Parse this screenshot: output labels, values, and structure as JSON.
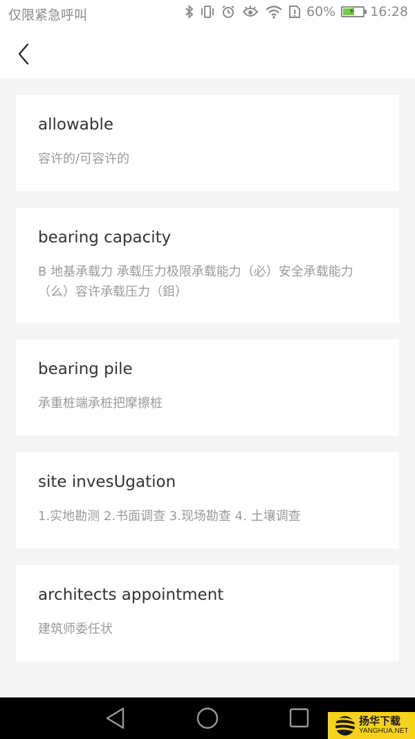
{
  "status_bar": {
    "carrier_text": "仅限紧急呼叫",
    "icons": [
      "bluetooth-icon",
      "vibrate-icon",
      "alarm-icon",
      "eye-comfort-icon",
      "wifi-icon",
      "sim-alert-icon"
    ],
    "battery_percent_text": "60%",
    "battery_level": 0.6,
    "battery_charging": true,
    "battery_color": "#6fcf3a",
    "time": "16:28"
  },
  "header": {
    "back_icon": "chevron-left-icon"
  },
  "vocab_list": [
    {
      "term": "allowable",
      "definition": "容许的/可容许的"
    },
    {
      "term": "bearing capacity",
      "definition": "B 地基承载力 承载压力极限承载能力（必）安全承载能力（么）容许承载压力（鉬）"
    },
    {
      "term": "bearing pile",
      "definition": "承重桩端承桩把摩擦桩"
    },
    {
      "term": "site invesUgation",
      "definition": "1.实地勘测 2.书面调查 3.现场勘查 4. 土壤调查"
    },
    {
      "term": "architects appointment",
      "definition": "建筑师委任状"
    }
  ],
  "nav_bar": {
    "buttons": [
      "back-triangle-icon",
      "home-circle-icon",
      "recents-square-icon"
    ]
  },
  "watermark": {
    "name_cn": "扬华下载",
    "name_en": "YANGHUA.NET",
    "color": "#f7d21a"
  }
}
